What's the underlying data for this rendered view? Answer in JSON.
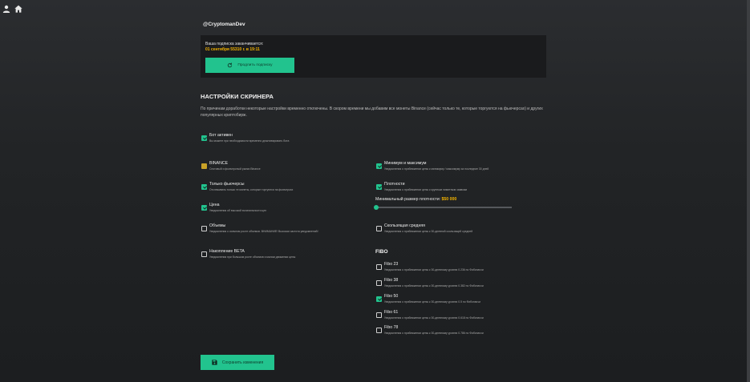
{
  "nav": {
    "profile_icon": "person-icon",
    "home_icon": "home-icon"
  },
  "user": {
    "handle": "@CryptomanDev"
  },
  "subscription": {
    "label": "Ваша подписка заканчивается:",
    "expires": "01 сентября 55310 г. в 19:11",
    "renew_label": "Продлить подписку"
  },
  "settings": {
    "title": "НАСТРОЙКИ СКРИНЕРА",
    "notice": "По причинам доработки некоторые настройки временно отключены. В скором времени мы добавим все монеты Binance (сейчас только те, которые торгуются на фьючерсах) и других популярных криптобирж."
  },
  "options": {
    "bot": {
      "title": "Бот активен",
      "desc": "Вы можете при необходимости временно деактивировать бота",
      "checked": true
    },
    "binance": {
      "title": "BINANCE",
      "desc": "Спотовый и фьючерсный рынки Binance",
      "checked": true
    },
    "futures": {
      "title": "Только фьючерсы",
      "desc": "Отслеживать только те монеты, которые торгуются на фьючерсах",
      "checked": true
    },
    "price": {
      "title": "Цена",
      "desc": "Уведомления об высокой волатильности цен",
      "checked": true
    },
    "volumes": {
      "title": "Объемы",
      "desc": "Уведомления о сильном росте объемов. ВНИМАНИЕ! Высокая частота уведомлений!",
      "checked": false
    },
    "accumulation": {
      "title": "Накопление BETA",
      "desc": "Уведомления при большом росте объемов и малом движении цены",
      "checked": false
    },
    "minmax": {
      "title": "Минимум и максимум",
      "desc": "Уведомления о приближении цены к минимуму / максимуму за последние 30 дней",
      "checked": true
    },
    "density": {
      "title": "Плотности",
      "desc": "Уведомления о приближении цены к крупным лимитным заявкам",
      "checked": true
    },
    "ma": {
      "title": "Скользящая средняя",
      "desc": "Уведомления о приближении цены к 30-дневной скользящей средней",
      "checked": false
    }
  },
  "density_slider": {
    "label": "Минимальный размер плотности:",
    "value": "$50 000",
    "fraction": 0.0
  },
  "fibo": {
    "title": "FIBO",
    "items": [
      {
        "title": "Fibo 23",
        "desc": "Уведомления о приближении цены к 30-дневному уровню 0.236 по Фибоначчи",
        "checked": false
      },
      {
        "title": "Fibo 38",
        "desc": "Уведомления о приближении цены к 30-дневному уровню 0.382 по Фибоначчи",
        "checked": false
      },
      {
        "title": "Fibo 50",
        "desc": "Уведомления о приближении цены к 30-дневному уровню 0.5 по Фибоначчи",
        "checked": true
      },
      {
        "title": "Fibo 61",
        "desc": "Уведомления о приближении цены к 30-дневному уровню 0.618 по Фибоначчи",
        "checked": false
      },
      {
        "title": "Fibo 78",
        "desc": "Уведомления о приближении цены к 30-дневному уровню 0.786 по Фибоначчи",
        "checked": false
      }
    ]
  },
  "save": {
    "label": "Сохранить изменения",
    "icon": "save-icon"
  },
  "colors": {
    "accent": "#22c38e",
    "highlight": "#f4b400",
    "disabled_check": "#c9a227"
  }
}
